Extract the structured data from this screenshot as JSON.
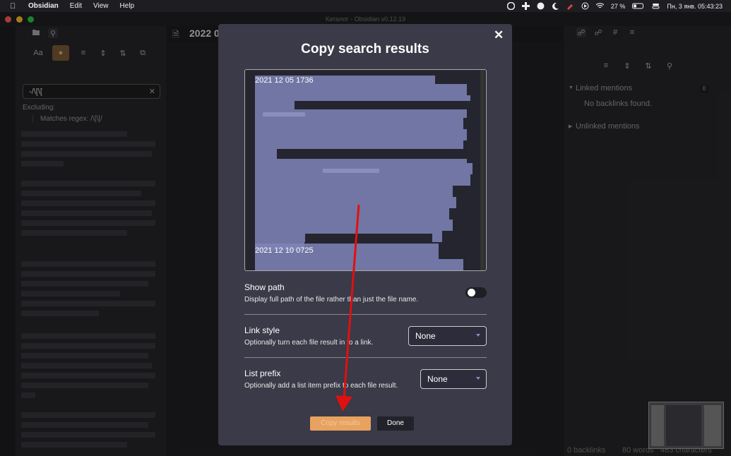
{
  "menubar": {
    "app": "Obsidian",
    "items": [
      "Edit",
      "View",
      "Help"
    ],
    "battery": "27 %",
    "datetime": "Пн, 3 янв.  05:43:23"
  },
  "window": {
    "title": "Каталог - Obsidian v0.12.19",
    "note_title": "2022 0"
  },
  "search": {
    "query": "-/\\[\\[",
    "excluding_label": "Excluding:",
    "excluding_item": "Matches regex: /\\[\\[/"
  },
  "backlinks": {
    "linked_label": "Linked mentions",
    "linked_count": "0",
    "no_backlinks": "No backlinks found.",
    "unlinked_label": "Unlinked mentions"
  },
  "status": {
    "backlinks": "0 backlinks",
    "words": "80 words",
    "chars": "463 characters"
  },
  "modal": {
    "title": "Copy search results",
    "close": "✕",
    "text_lines": [
      "2021 12 05 1736",
      "2021 12 10 0725"
    ],
    "show_path": {
      "name": "Show path",
      "desc": "Display full path of the file rather than just the file name.",
      "enabled": false
    },
    "link_style": {
      "name": "Link style",
      "desc": "Optionally turn each file result in to a link.",
      "value": "None"
    },
    "list_prefix": {
      "name": "List prefix",
      "desc": "Optionally add a list item prefix to each file result.",
      "value": "None"
    },
    "copy_button": "Copy results",
    "done_button": "Done"
  },
  "colors": {
    "accent": "#e8a260",
    "annotation_arrow": "#e01010"
  }
}
